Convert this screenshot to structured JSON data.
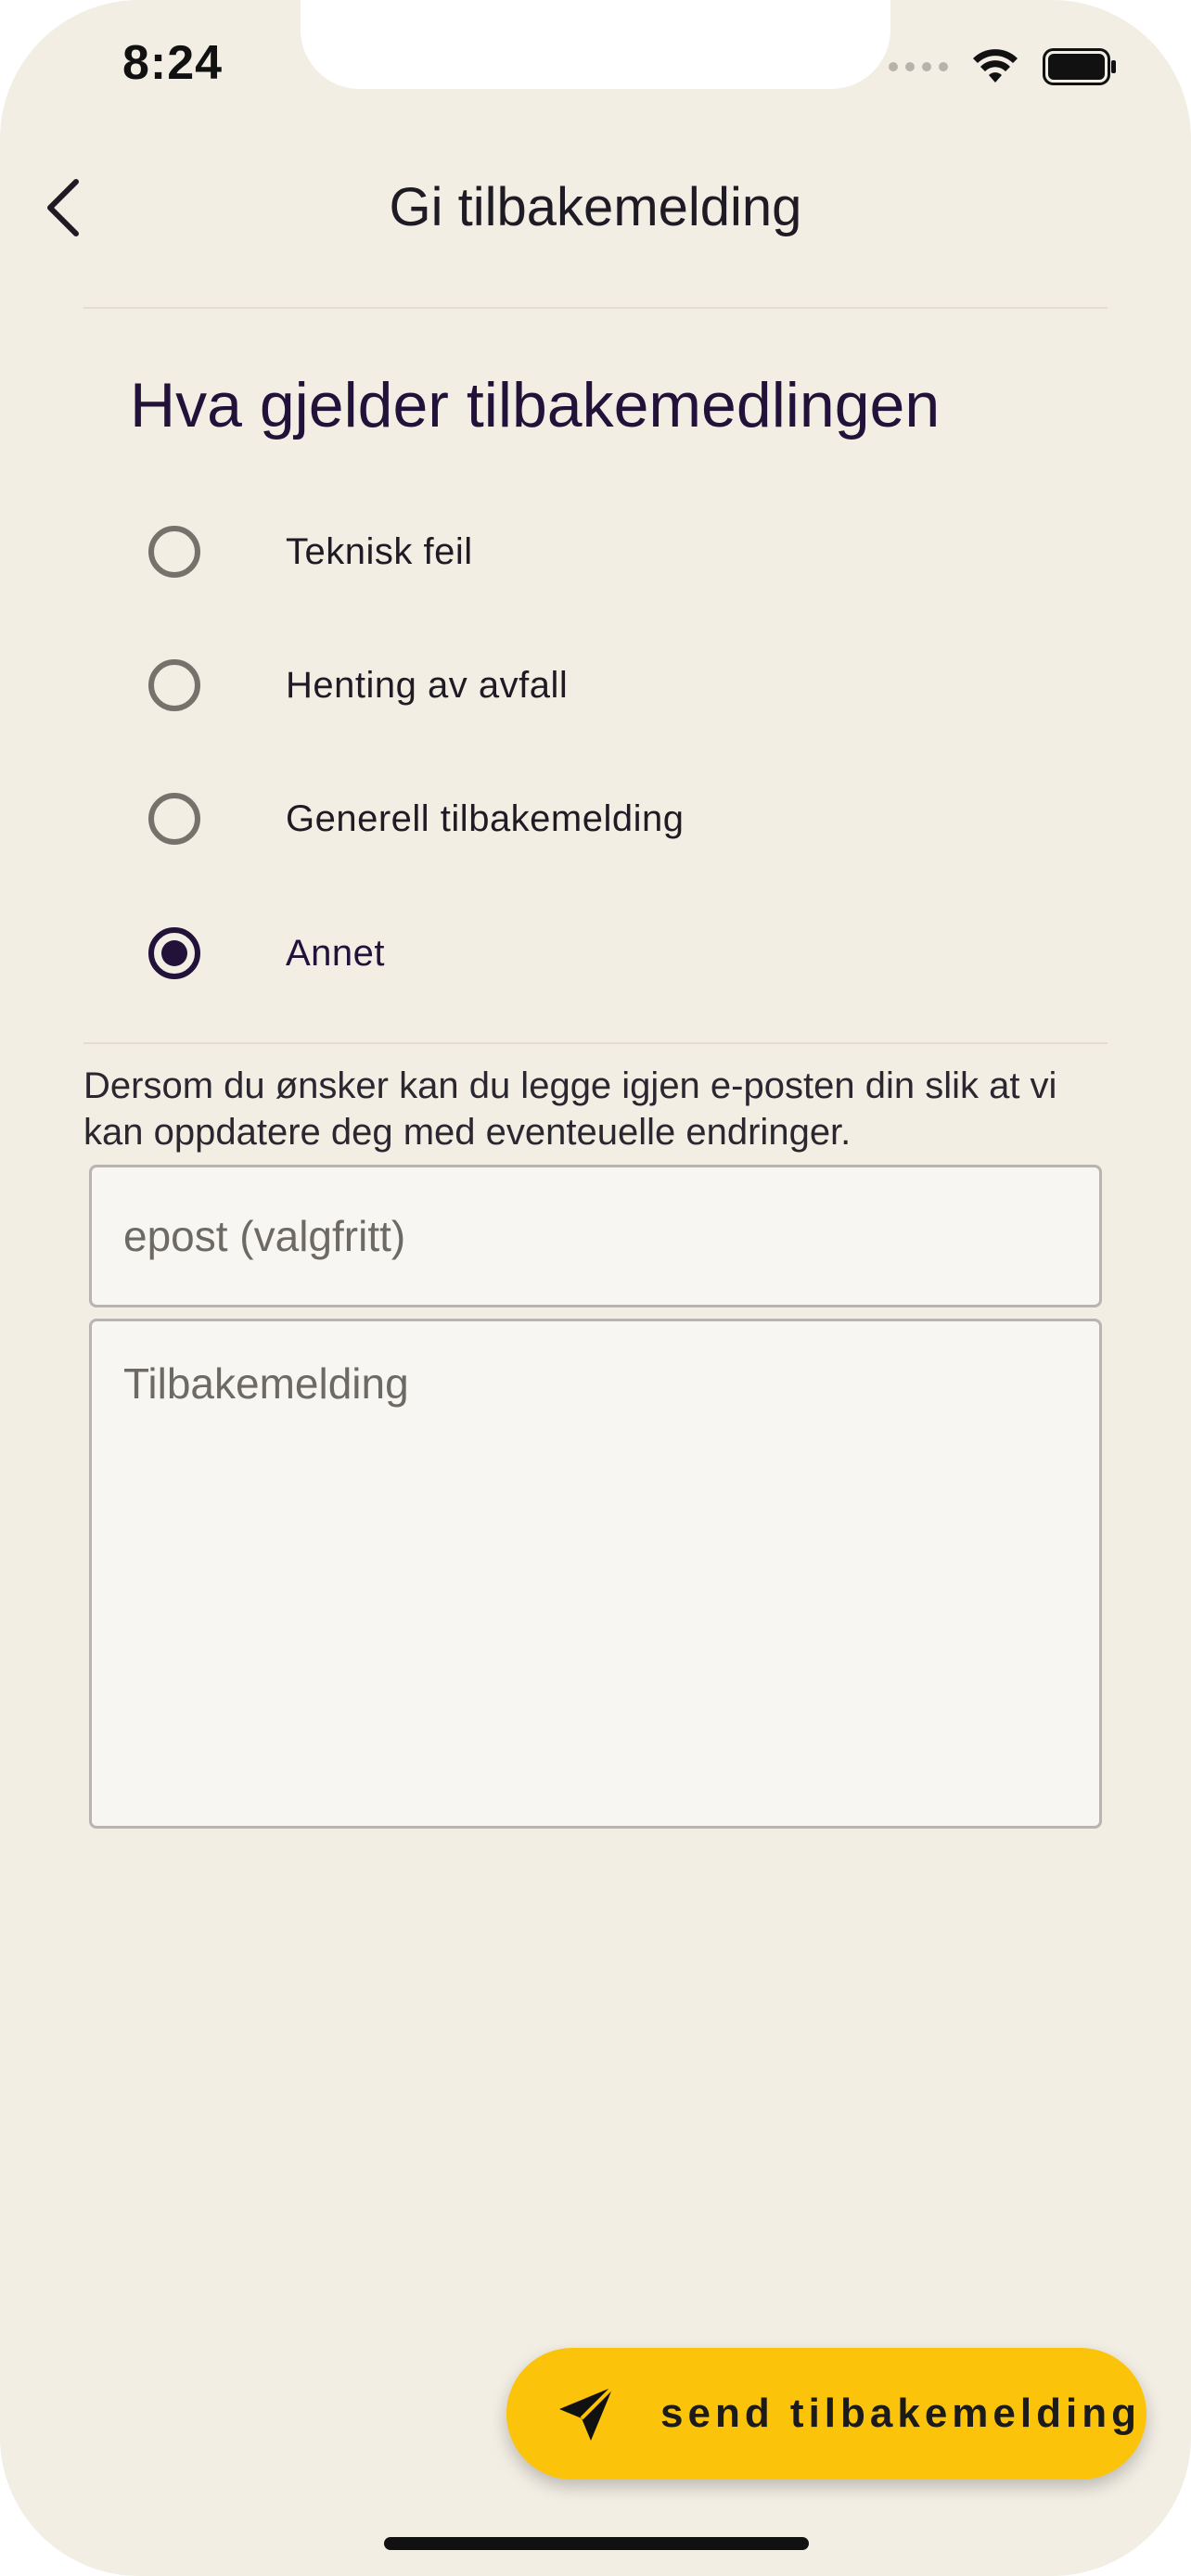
{
  "status_bar": {
    "time": "8:24",
    "icons": [
      "cellular-signal-icon",
      "wifi-icon",
      "battery-icon"
    ]
  },
  "header": {
    "title": "Gi tilbakemelding",
    "back_icon": "chevron-left-icon"
  },
  "section": {
    "title": "Hva gjelder tilbakemedlingen"
  },
  "options": [
    {
      "label": "Teknisk feil",
      "selected": false
    },
    {
      "label": "Henting av avfall",
      "selected": false
    },
    {
      "label": "Generell tilbakemelding",
      "selected": false
    },
    {
      "label": "Annet",
      "selected": true
    }
  ],
  "helper_text": "Dersom du ønsker kan du legge igjen e-posten din slik at vi kan oppdatere deg med eventeuelle endringer.",
  "email": {
    "placeholder": "epost (valgfritt)",
    "value": ""
  },
  "feedback": {
    "placeholder": "Tilbakemelding",
    "value": ""
  },
  "send_button": {
    "label": "send tilbakemelding",
    "icon": "send-icon"
  },
  "colors": {
    "background": "#f2eee4",
    "accent": "#fcc30b",
    "primary_text": "#22123a"
  }
}
